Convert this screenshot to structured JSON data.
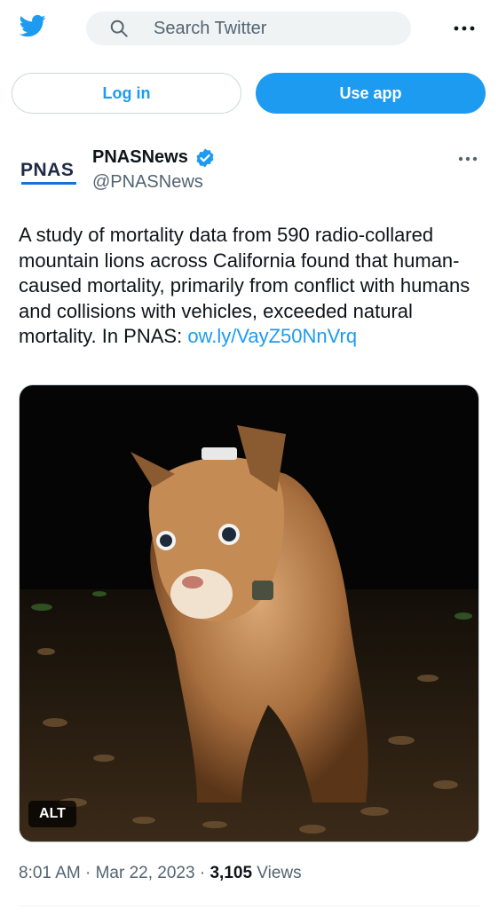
{
  "header": {
    "logo_icon": "twitter-bird-icon",
    "search_placeholder": "Search Twitter",
    "more_icon": "more-horizontal-icon",
    "accent": "#1d9bf0"
  },
  "auth": {
    "login_label": "Log in",
    "use_app_label": "Use app"
  },
  "tweet": {
    "avatar_text": "PNAS",
    "author_name": "PNASNews",
    "verified_icon": "verified-badge-icon",
    "handle": "@PNASNews",
    "body_text": "A study of mortality data from 590 radio-collared mountain lions across California found that human-caused mortality, primarily from conflict with humans and collisions with vehicles, exceeded natural mortality. In PNAS: ",
    "link_text": "ow.ly/VayZ50NnVrq",
    "media_alt_badge": "ALT",
    "time": "8:01 AM",
    "separator": "·",
    "date": "Mar 22, 2023",
    "views_count": "3,105",
    "views_label": "Views"
  }
}
